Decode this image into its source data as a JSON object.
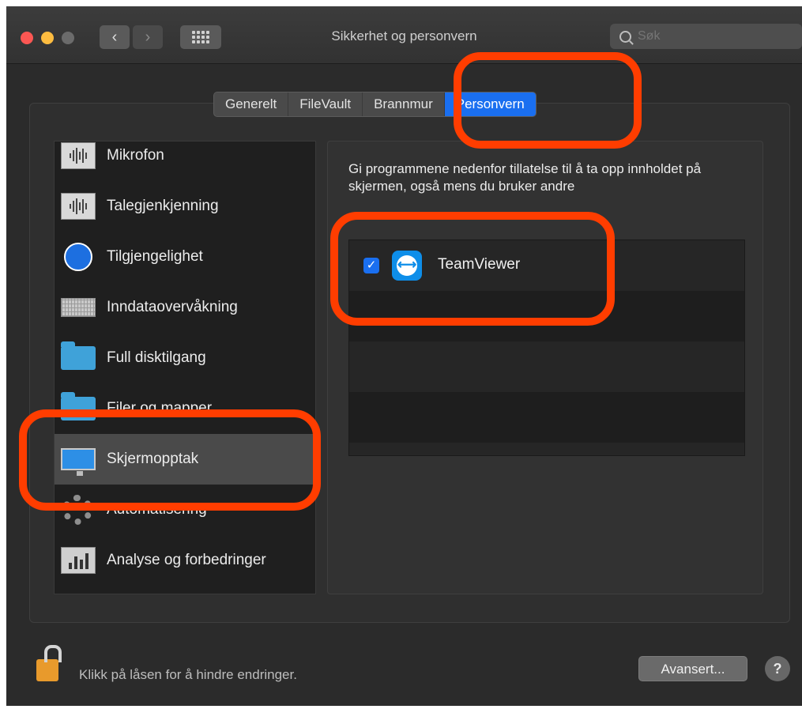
{
  "window": {
    "title": "Sikkerhet og personvern",
    "search_placeholder": "Søk"
  },
  "tabs": [
    "Generelt",
    "FileVault",
    "Brannmur",
    "Personvern"
  ],
  "active_tab": "Personvern",
  "sidebar": {
    "items": [
      {
        "label": "Mikrofon",
        "icon": "microphone-wave-icon"
      },
      {
        "label": "Talegjenkjenning",
        "icon": "speech-wave-icon"
      },
      {
        "label": "Tilgjengelighet",
        "icon": "accessibility-icon"
      },
      {
        "label": "Inndataovervåkning",
        "icon": "keyboard-icon"
      },
      {
        "label": "Full disktilgang",
        "icon": "folder-icon"
      },
      {
        "label": "Filer og mapper",
        "icon": "folder-icon"
      },
      {
        "label": "Skjermopptak",
        "icon": "monitor-icon"
      },
      {
        "label": "Automatisering",
        "icon": "gear-icon"
      },
      {
        "label": "Analyse og forbedringer",
        "icon": "bar-chart-icon"
      }
    ],
    "selected": "Skjermopptak"
  },
  "panel": {
    "description": "Gi programmene nedenfor tillatelse til å ta opp innholdet på skjermen, også mens du bruker andre",
    "apps": [
      {
        "name": "TeamViewer",
        "checked": true,
        "icon": "teamviewer-icon"
      }
    ]
  },
  "footer": {
    "lock_text": "Klikk på låsen for å hindre endringer.",
    "advanced_label": "Avansert...",
    "help_label": "?"
  },
  "colors": {
    "accent": "#1a6ff0",
    "annotation": "#ff3d00",
    "window_bg": "#2b2b2b"
  }
}
